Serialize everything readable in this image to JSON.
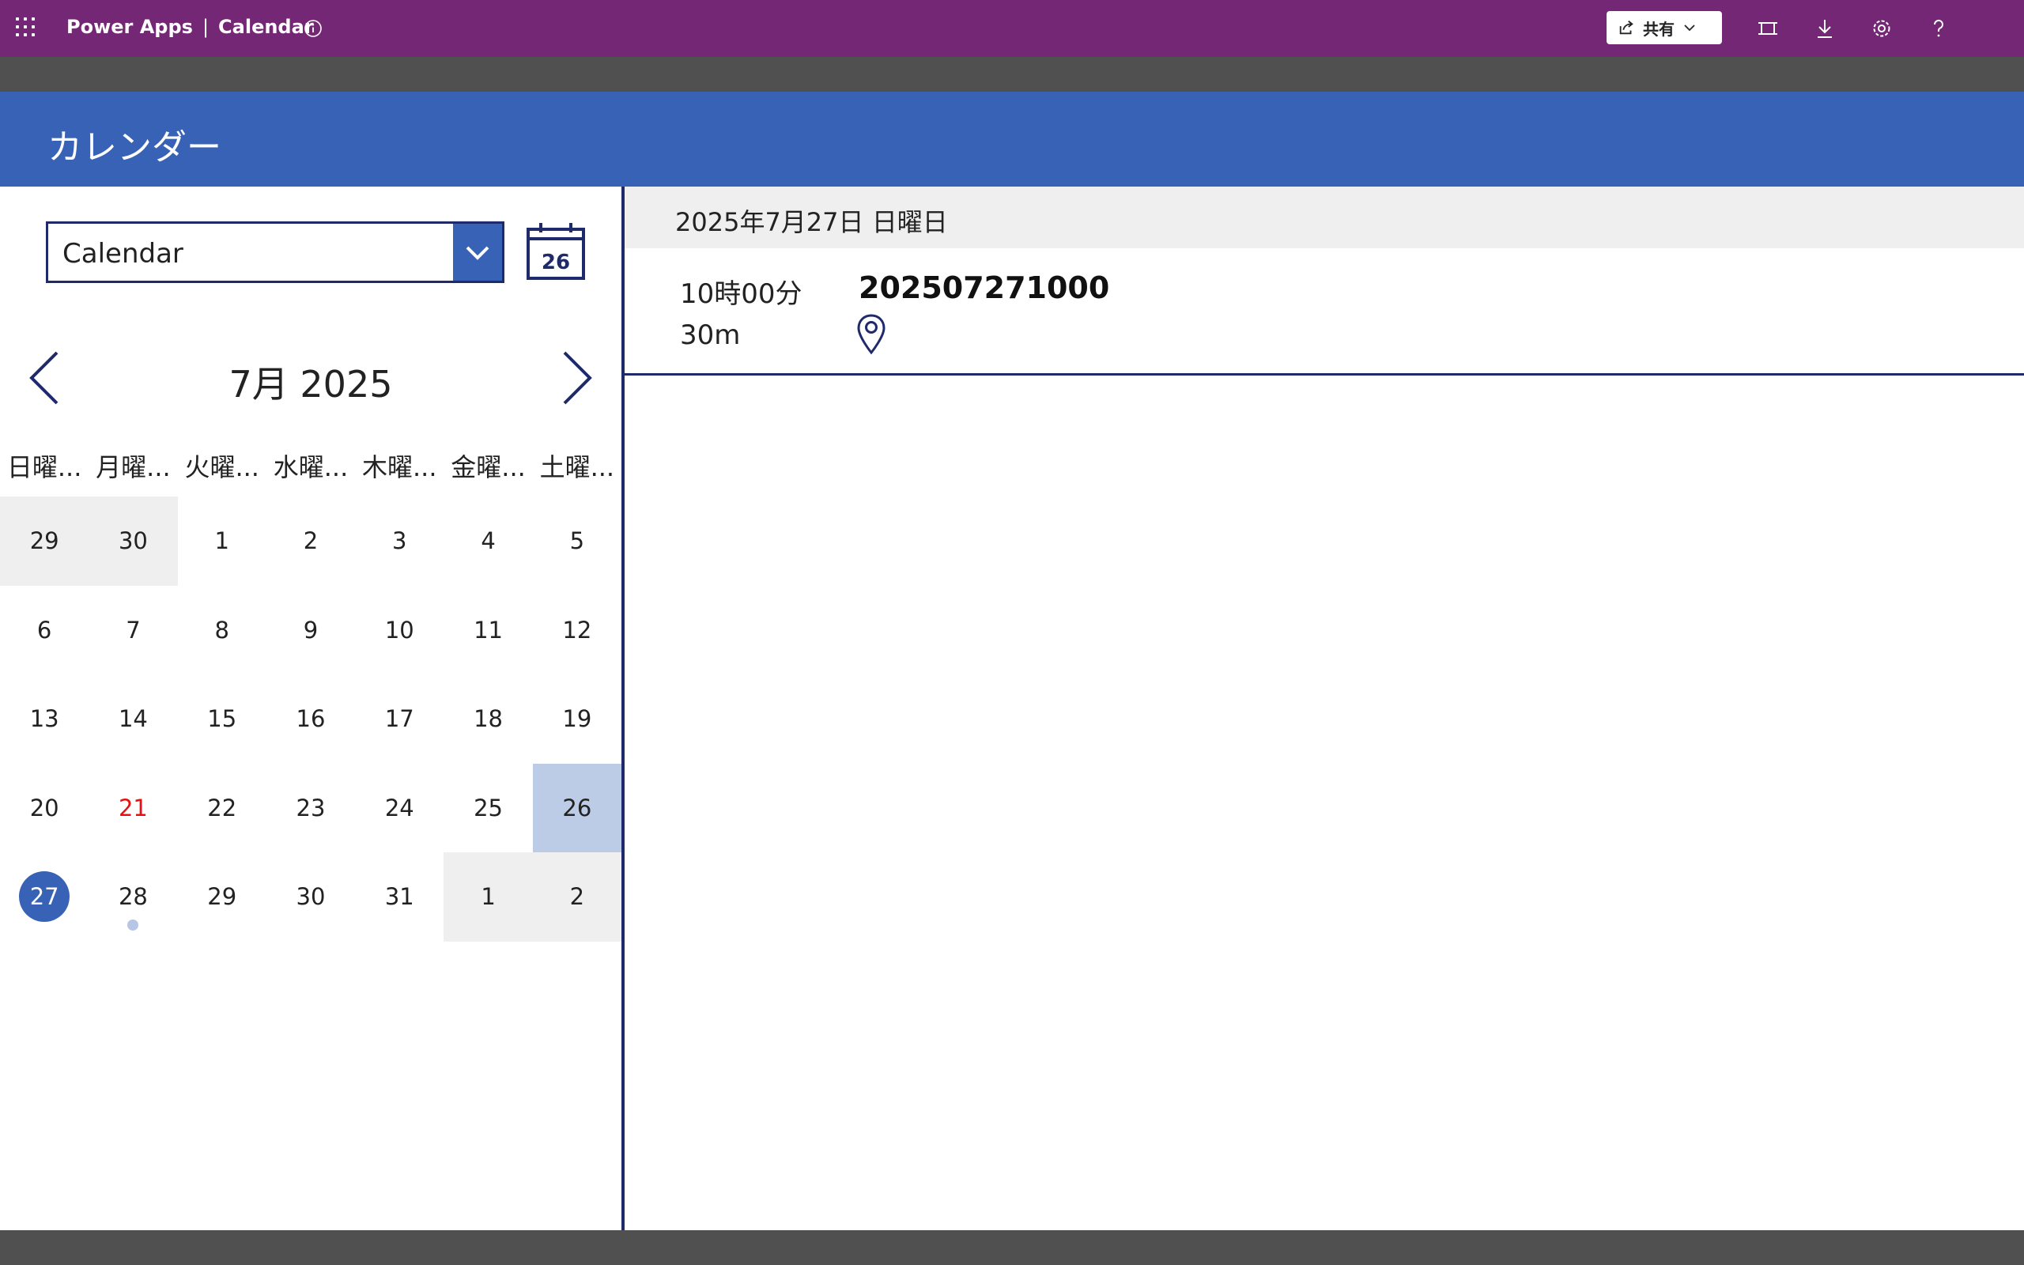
{
  "topbar": {
    "app_name": "Power Apps",
    "separator": "|",
    "app_title": "Calendar",
    "share_label": "共有"
  },
  "header": {
    "title": "カレンダー"
  },
  "left": {
    "calendar_dropdown_value": "Calendar",
    "today_icon_number": "26",
    "month_label": "7月 2025",
    "weekdays": [
      "日曜...",
      "月曜...",
      "火曜...",
      "水曜...",
      "木曜...",
      "金曜...",
      "土曜..."
    ],
    "weeks": [
      [
        {
          "d": "29",
          "other": true
        },
        {
          "d": "30",
          "other": true
        },
        {
          "d": "1"
        },
        {
          "d": "2"
        },
        {
          "d": "3"
        },
        {
          "d": "4"
        },
        {
          "d": "5"
        }
      ],
      [
        {
          "d": "6"
        },
        {
          "d": "7"
        },
        {
          "d": "8"
        },
        {
          "d": "9"
        },
        {
          "d": "10"
        },
        {
          "d": "11"
        },
        {
          "d": "12"
        }
      ],
      [
        {
          "d": "13"
        },
        {
          "d": "14"
        },
        {
          "d": "15"
        },
        {
          "d": "16"
        },
        {
          "d": "17"
        },
        {
          "d": "18"
        },
        {
          "d": "19"
        }
      ],
      [
        {
          "d": "20"
        },
        {
          "d": "21",
          "holiday": true
        },
        {
          "d": "22"
        },
        {
          "d": "23"
        },
        {
          "d": "24"
        },
        {
          "d": "25"
        },
        {
          "d": "26",
          "selected": true
        }
      ],
      [
        {
          "d": "27",
          "today": true
        },
        {
          "d": "28",
          "dot": true
        },
        {
          "d": "29"
        },
        {
          "d": "30"
        },
        {
          "d": "31"
        },
        {
          "d": "1",
          "other": true
        },
        {
          "d": "2",
          "other": true
        }
      ]
    ]
  },
  "right": {
    "date_header": "2025年7月27日 日曜日",
    "events": [
      {
        "time": "10時00分",
        "duration": "30m",
        "title": "202507271000"
      }
    ]
  },
  "colors": {
    "topbar": "#742774",
    "header": "#3862b5",
    "accent": "#3862b5",
    "navy": "#1f2a6b",
    "selected_day": "#bccbe6",
    "holiday": "#e81010",
    "other_month": "#efefef"
  }
}
